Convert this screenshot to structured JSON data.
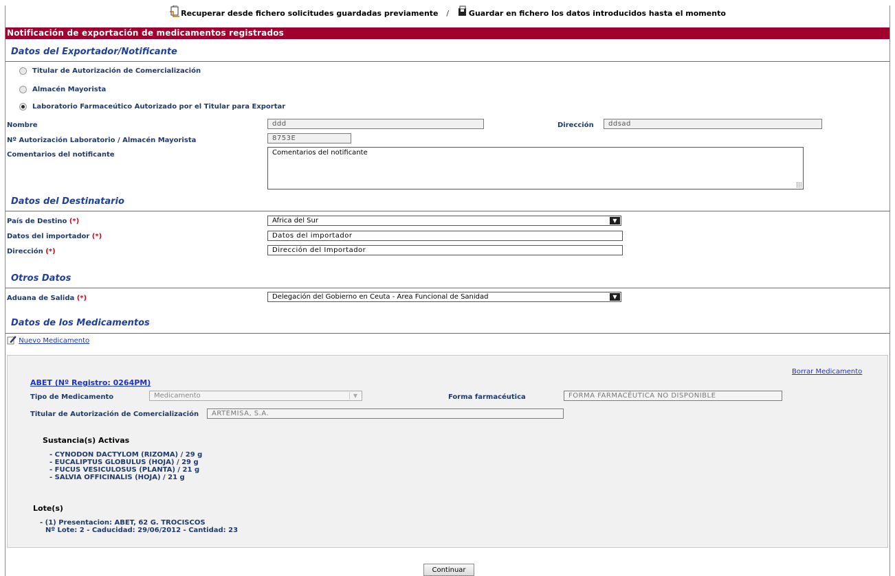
{
  "toplinks": {
    "recover": "Recuperar desde fichero solicitudes guardadas previamente",
    "separator": "/",
    "save": "Guardar en fichero los datos introducidos hasta el momento"
  },
  "banner": "Notificación de exportación de medicamentos registrados",
  "exporter": {
    "title": "Datos del Exportador/Notificante",
    "options": [
      "Titular de Autorización de Comercialización",
      "Almacén Mayorista",
      "Laboratorio Farmaceútico Autorizado por el Titular para Exportar"
    ],
    "selected_index": 2,
    "nombre_label": "Nombre",
    "nombre_value": "ddd",
    "direccion_label": "Dirección",
    "direccion_value": "ddsad",
    "autorizacion_label": "Nº Autorización Laboratorio / Almacén Mayorista",
    "autorizacion_value": "8753E",
    "comentarios_label": "Comentarios del notificante",
    "comentarios_value": "Comentarios del notificante"
  },
  "destinatario": {
    "title": "Datos del Destinatario",
    "pais_label": "País de Destino",
    "pais_value": "Africa del Sur",
    "importador_label": "Datos del importador",
    "importador_value": "Datos del importador",
    "direccion_label": "Dirección",
    "direccion_value": "Dirección del Importador",
    "required_mark": "(*)"
  },
  "otros": {
    "title": "Otros Datos",
    "aduana_label": "Aduana de Salida",
    "aduana_value": "Delegación del Gobierno en Ceuta - Area Funcional de Sanidad"
  },
  "medicamentos": {
    "title": "Datos de los Medicamentos",
    "nuevo_link": "Nuevo Medicamento",
    "borrar_link": "Borrar Medicamento",
    "med_title": "ABET (Nº Registro: 0264PM)",
    "tipo_label": "Tipo de Medicamento",
    "tipo_value": "Medicamento",
    "forma_label": "Forma farmacéutica",
    "forma_value": "FORMA FARMACÉUTICA NO DISPONIBLE",
    "titular_label": "Titular de Autorización de Comercialización",
    "titular_value": "ARTEMISA, S.A.",
    "sustancias_title": "Sustancia(s) Activas",
    "sustancias": [
      "- CYNODON DACTYLOM (RIZOMA) /  29 g",
      "- EUCALIPTUS GLOBULUS (HOJA) /  29 g",
      "- FUCUS VESICULOSUS (PLANTA) /  21 g",
      "- SALVIA OFFICINALIS (HOJA) /  21 g"
    ],
    "lotes_title": "Lote(s)",
    "lote_line1": "- (1)  Presentacion: ABET, 62 G. TROCISCOS",
    "lote_line2": "Nº Lote: 2 -  Caducidad: 29/06/2012 -  Cantidad: 23"
  },
  "continuar": "Continuar",
  "colors": {
    "banner": "#a0002d",
    "section": "#1f3f9f",
    "label": "#1f3a6b",
    "required": "#d0021b",
    "link": "#1a33c8"
  },
  "icons": [
    "folder-open-icon",
    "save-disk-icon",
    "pencil-edit-icon",
    "chevron-down-icon"
  ]
}
